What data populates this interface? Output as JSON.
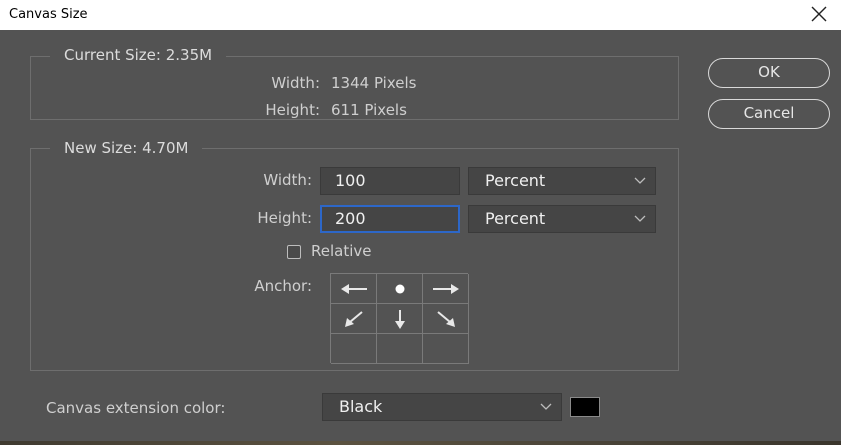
{
  "dialog": {
    "title": "Canvas Size",
    "close_icon": "close-icon"
  },
  "current_size": {
    "legend": "Current Size: 2.35M",
    "width_label": "Width:",
    "width_value": "1344 Pixels",
    "height_label": "Height:",
    "height_value": "611 Pixels"
  },
  "new_size": {
    "legend": "New Size: 4.70M",
    "width_label": "Width:",
    "width_value": "100",
    "width_unit": "Percent",
    "height_label": "Height:",
    "height_value": "200",
    "height_unit": "Percent",
    "relative_label": "Relative",
    "relative_checked": false,
    "anchor_label": "Anchor:",
    "anchor_icons": [
      [
        "arrow-left-icon",
        "anchor-dot-icon",
        "arrow-right-icon"
      ],
      [
        "arrow-down-left-icon",
        "arrow-down-icon",
        "arrow-down-right-icon"
      ],
      [
        "",
        "",
        ""
      ]
    ]
  },
  "buttons": {
    "ok_label": "OK",
    "cancel_label": "Cancel"
  },
  "extension": {
    "label": "Canvas extension color:",
    "value": "Black",
    "swatch_color": "#000000"
  },
  "colors": {
    "background": "#535353",
    "focus": "#2d67c8"
  }
}
